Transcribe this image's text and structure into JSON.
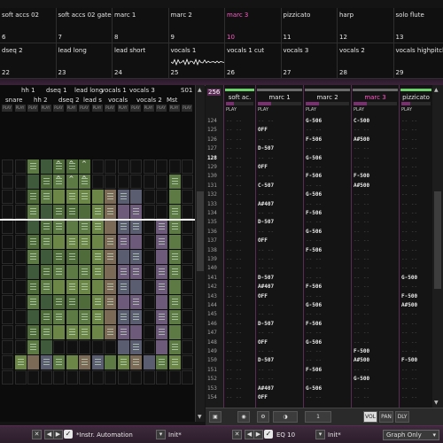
{
  "instruments": [
    {
      "name": "soft accs 02",
      "num": "6"
    },
    {
      "name": "soft accs 02 gated",
      "num": "7"
    },
    {
      "name": "marc 1",
      "num": "8"
    },
    {
      "name": "marc 2",
      "num": "9"
    },
    {
      "name": "marc 3",
      "num": "10",
      "selected": true
    },
    {
      "name": "pizzicato",
      "num": "11"
    },
    {
      "name": "harp",
      "num": "12"
    },
    {
      "name": "solo flute",
      "num": "13"
    },
    {
      "name": "dseq 2",
      "num": "22"
    },
    {
      "name": "lead long",
      "num": "23"
    },
    {
      "name": "lead short",
      "num": "24"
    },
    {
      "name": "vocals 1",
      "num": "25",
      "wave": true
    },
    {
      "name": "vocals 1 cut",
      "num": "26"
    },
    {
      "name": "vocals 3",
      "num": "27"
    },
    {
      "name": "vocals 2",
      "num": "28"
    },
    {
      "name": "vocals highpitch",
      "num": "29"
    }
  ],
  "matrix": {
    "headers_top": [
      "hh 1",
      "dseq 1",
      "lead long",
      "vocals 1",
      "vocals 3",
      "S01"
    ],
    "headers_bottom": [
      "snare",
      "hh 2",
      "dseq 2",
      "lead s",
      "vocals",
      "vocals 2",
      "Mst"
    ],
    "mute_label": "PLAY",
    "scroll_up": "▲",
    "scroll_down": "▼"
  },
  "pattern": {
    "line_count_label": "256",
    "tracks": [
      {
        "name": "soft ac.",
        "play": "PLAY",
        "top": "green"
      },
      {
        "name": "marc 1",
        "play": "PLAY"
      },
      {
        "name": "marc 2",
        "play": "PLAY"
      },
      {
        "name": "marc 3",
        "play": "PLAY",
        "selected": true
      },
      {
        "name": "pizzicato",
        "play": "PLAY",
        "top": "green"
      }
    ],
    "lines": [
      {
        "n": "124",
        "c": [
          "",
          "",
          "G-506",
          "C-500",
          ""
        ]
      },
      {
        "n": "125",
        "c": [
          "",
          "OFF",
          "",
          "",
          ""
        ]
      },
      {
        "n": "126",
        "c": [
          "",
          "",
          "F-506",
          "A#500",
          ""
        ]
      },
      {
        "n": "127",
        "c": [
          "",
          "D-507",
          "",
          "",
          ""
        ]
      },
      {
        "n": "128",
        "c": [
          "",
          "",
          "G-506",
          "",
          ""
        ]
      },
      {
        "n": "129",
        "c": [
          "",
          "OFF",
          "",
          "",
          ""
        ]
      },
      {
        "n": "130",
        "c": [
          "",
          "",
          "F-506",
          "F-500",
          ""
        ]
      },
      {
        "n": "131",
        "c": [
          "",
          "C-507",
          "",
          "A#500",
          ""
        ]
      },
      {
        "n": "132",
        "c": [
          "",
          "",
          "G-506",
          "",
          ""
        ]
      },
      {
        "n": "133",
        "c": [
          "",
          "A#407",
          "",
          "",
          ""
        ]
      },
      {
        "n": "134",
        "c": [
          "",
          "",
          "F-506",
          "",
          ""
        ]
      },
      {
        "n": "135",
        "c": [
          "",
          "D-507",
          "",
          "",
          ""
        ]
      },
      {
        "n": "136",
        "c": [
          "",
          "",
          "G-506",
          "",
          ""
        ]
      },
      {
        "n": "137",
        "c": [
          "",
          "OFF",
          "",
          "",
          ""
        ]
      },
      {
        "n": "138",
        "c": [
          "",
          "",
          "F-506",
          "",
          ""
        ]
      },
      {
        "n": "139",
        "c": [
          "",
          "",
          "",
          "",
          ""
        ]
      },
      {
        "n": "140",
        "c": [
          "",
          "",
          "",
          "",
          ""
        ]
      },
      {
        "n": "141",
        "c": [
          "",
          "D-507",
          "",
          "",
          "G-500"
        ]
      },
      {
        "n": "142",
        "c": [
          "",
          "A#407",
          "F-506",
          "",
          ""
        ]
      },
      {
        "n": "143",
        "c": [
          "",
          "OFF",
          "",
          "",
          "F-500"
        ]
      },
      {
        "n": "144",
        "c": [
          "",
          "",
          "G-506",
          "",
          "A#500"
        ]
      },
      {
        "n": "145",
        "c": [
          "",
          "",
          "",
          "",
          ""
        ]
      },
      {
        "n": "146",
        "c": [
          "",
          "D-507",
          "F-506",
          "",
          ""
        ]
      },
      {
        "n": "147",
        "c": [
          "",
          "",
          "",
          "",
          ""
        ]
      },
      {
        "n": "148",
        "c": [
          "",
          "OFF",
          "G-506",
          "",
          ""
        ]
      },
      {
        "n": "149",
        "c": [
          "",
          "",
          "",
          "F-500",
          ""
        ]
      },
      {
        "n": "150",
        "c": [
          "",
          "D-507",
          "",
          "A#500",
          "F-500"
        ]
      },
      {
        "n": "151",
        "c": [
          "",
          "",
          "F-506",
          "",
          ""
        ]
      },
      {
        "n": "152",
        "c": [
          "",
          "",
          "",
          "G-500",
          ""
        ]
      },
      {
        "n": "153",
        "c": [
          "",
          "A#407",
          "G-506",
          "",
          ""
        ]
      },
      {
        "n": "154",
        "c": [
          "",
          "OFF",
          "",
          "",
          ""
        ]
      }
    ],
    "highlight_line": "128",
    "scroll_up": "▲",
    "scroll_down": "▼",
    "bottom": {
      "octave": "1",
      "vol": "VOL",
      "pan": "PAN",
      "dly": "DLY"
    }
  },
  "status": {
    "instr_automation": "*Instr. Automation",
    "init1": "Init*",
    "eq": "EQ 10",
    "init2": "Init*",
    "graph_mode": "Graph Only"
  },
  "colors": {
    "accent": "#ff5ac8",
    "frame": "#5a2c55",
    "note_vol": "#7fe07f"
  }
}
